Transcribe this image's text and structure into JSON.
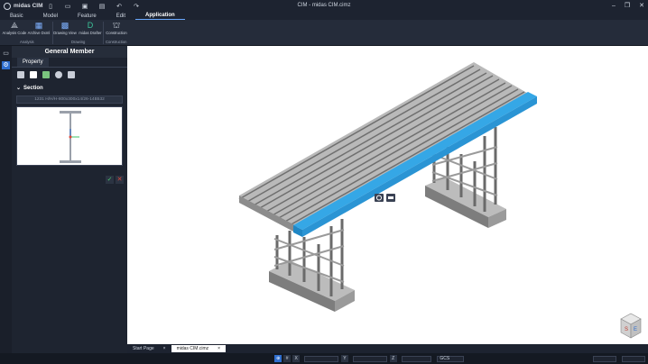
{
  "app": {
    "name": "midas CIM",
    "title": "CIM - midas CIM.cimz"
  },
  "menu": [
    "Basic",
    "Model",
    "Feature",
    "Edit",
    "Application"
  ],
  "ribbon": {
    "buttons": [
      "Analysis Code",
      "Archive Dxml",
      "Drawing View",
      "midas Drafter",
      "Construction"
    ],
    "groups": [
      "Analysis",
      "Drawing",
      "Construction"
    ]
  },
  "panel": {
    "title": "General Member",
    "tab": "Property",
    "section_label": "Section",
    "section_value": "1231 H/H/H-800x300x14/26-14B532"
  },
  "doc_tabs": [
    "Start Page",
    "midas CIM.cimz"
  ],
  "status": {
    "x": "X",
    "y": "Y",
    "z": "Z",
    "coord": "GCS"
  },
  "colors": {
    "accent": "#2f6ecf",
    "highlight": "#35a7e6"
  }
}
